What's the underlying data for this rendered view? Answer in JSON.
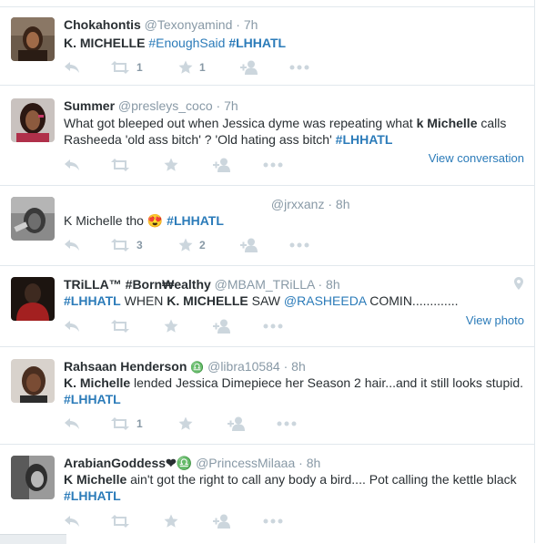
{
  "tweets": [
    {
      "fullname": "Chokahontis",
      "username": "@Texonyamind",
      "time": "7h",
      "text_parts": [
        "K. MICHELLE",
        "#EnoughSaid",
        "#LHHATL"
      ],
      "retweets": "1",
      "favorites": "1"
    },
    {
      "fullname": "Summer",
      "username": "@presleys_coco",
      "time": "7h",
      "text_a": "What got bleeped out when Jessica dyme was repeating what",
      "text_b": "k Michelle",
      "text_c": "calls Rasheeda 'old ass bitch' ? 'Old hating ass bitch'",
      "hashtag": "#LHHATL",
      "link": "View conversation"
    },
    {
      "fullname": "",
      "username": "@jrxxanz",
      "time": "8h",
      "text_a": "K Michelle tho",
      "emoji": "😍",
      "hashtag": "#LHHATL",
      "retweets": "3",
      "favorites": "2"
    },
    {
      "fullname": "TRiLLA™ #Born₩ealthy",
      "username": "@MBAM_TRiLLA",
      "time": "8h",
      "hashtag": "#LHHATL",
      "text_a": "WHEN",
      "text_b": "K. MICHELLE",
      "text_c": "SAW",
      "mention": "@RASHEEDA",
      "text_d": "COMIN.............",
      "link": "View photo"
    },
    {
      "fullname": "Rahsaan Henderson",
      "symbol": "♎",
      "username": "@libra10584",
      "time": "8h",
      "text_a": "K. Michelle",
      "text_b": "lended Jessica Dimepiece her Season 2 hair...and it still looks stupid.",
      "hashtag": "#LHHATL",
      "retweets": "1"
    },
    {
      "fullname": "ArabianGoddess❤♎",
      "username": "@PrincessMilaaa",
      "time": "8h",
      "text_a": "K Michelle",
      "text_b": "ain't got the right to call any body a bird.... Pot calling the kettle black",
      "hashtag": "#LHHATL"
    }
  ],
  "separator": "·",
  "icons": {
    "reply": "reply-icon",
    "retweet": "retweet-icon",
    "favorite": "star-icon",
    "follow": "follow-icon",
    "more": "more-icon",
    "location": "location-pin-icon"
  },
  "colors": {
    "link": "#2b7bb9",
    "muted": "#8899a6",
    "text": "#292f33",
    "action_icon": "#ccd6dd",
    "divider": "#e1e8ed"
  }
}
